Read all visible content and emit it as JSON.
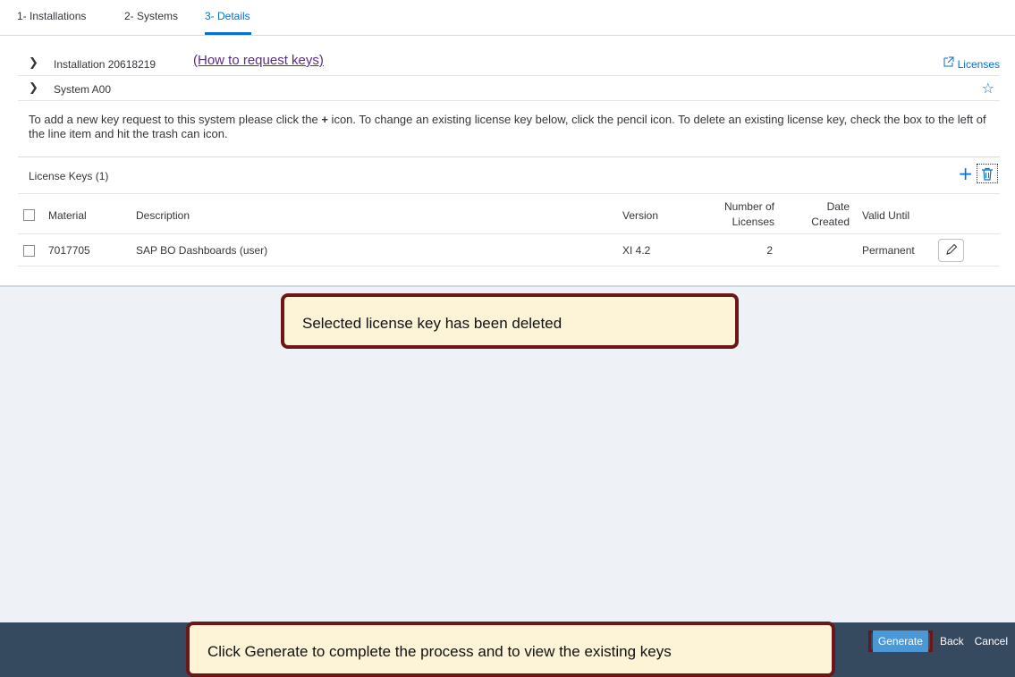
{
  "tabs": [
    {
      "label": "1- Installations"
    },
    {
      "label": "2- Systems"
    },
    {
      "label": "3- Details"
    }
  ],
  "installation": {
    "label": "Installation 20618219",
    "help_link": "(How to request keys)",
    "licenses_link": "Licenses"
  },
  "system": {
    "label": "System A00"
  },
  "instructions": {
    "part1": "To add a new key request to this system please click the ",
    "plus": "+",
    "part2": " icon. To change an existing license key below, click the pencil icon. To delete an existing license key, check the box to the left of the line item and hit the trash can icon."
  },
  "license_keys": {
    "title": "License Keys (1)",
    "columns": {
      "material": "Material",
      "description": "Description",
      "version": "Version",
      "num_licenses_1": "Number of",
      "num_licenses_2": "Licenses",
      "date_created_1": "Date",
      "date_created_2": "Created",
      "valid_until": "Valid Until"
    },
    "rows": [
      {
        "material": "7017705",
        "description": "SAP BO Dashboards (user)",
        "version": "XI 4.2",
        "num_licenses": "2",
        "date_created": "",
        "valid_until": "Permanent"
      }
    ]
  },
  "footer": {
    "generate": "Generate",
    "back": "Back",
    "cancel": "Cancel"
  },
  "callouts": {
    "deleted": "Selected license key has been deleted",
    "generate_hint": "Click Generate to complete the process and to view the existing keys"
  },
  "colors": {
    "accent": "#0a6ed1",
    "footer_bg": "#354a5f",
    "callout_border": "#6b1717",
    "callout_bg": "#fdf3d6",
    "generate_bg": "#4a98d6"
  }
}
